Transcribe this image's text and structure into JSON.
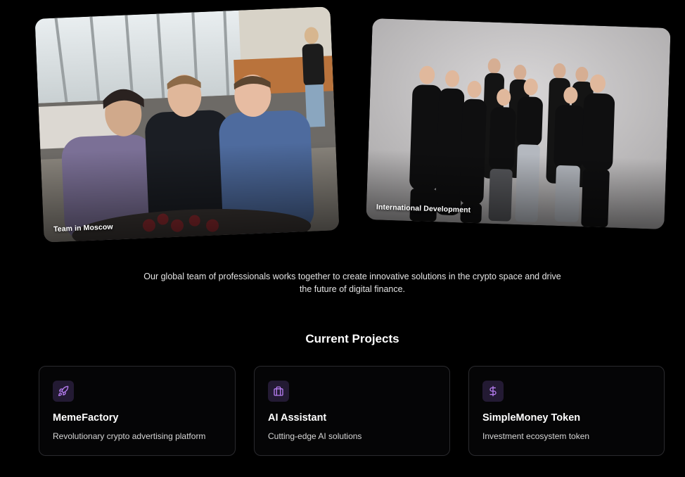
{
  "photos": [
    {
      "caption": "Team in Moscow",
      "image": "team-moscow-photo"
    },
    {
      "caption": "International Development",
      "image": "international-development-photo"
    }
  ],
  "description": "Our global team of professionals works together to create innovative solutions in the crypto space and drive the future of digital finance.",
  "projects_section": {
    "title": "Current Projects",
    "items": [
      {
        "icon": "rocket-icon",
        "title": "MemeFactory",
        "description": "Revolutionary crypto advertising platform"
      },
      {
        "icon": "briefcase-icon",
        "title": "AI Assistant",
        "description": "Cutting-edge AI solutions"
      },
      {
        "icon": "dollar-icon",
        "title": "SimpleMoney Token",
        "description": "Investment ecosystem token"
      }
    ]
  },
  "colors": {
    "background": "#000000",
    "card_border": "#2a2a2e",
    "icon_bg": "#231a33",
    "accent_purple": "#b57cf0"
  }
}
